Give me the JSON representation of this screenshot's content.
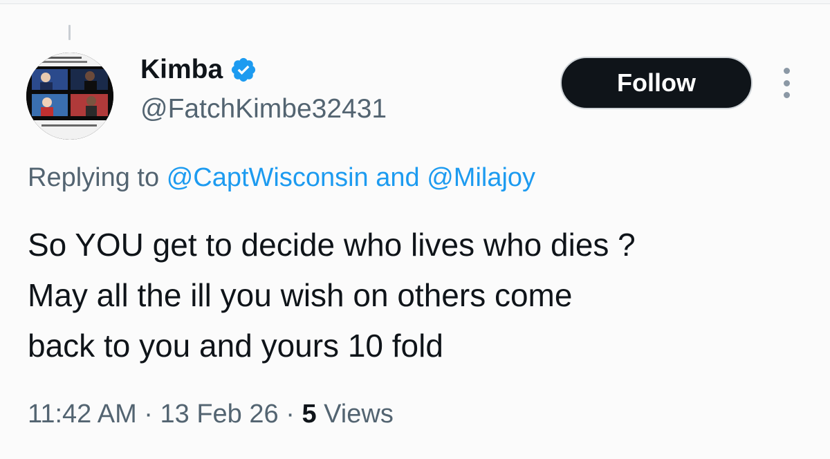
{
  "author": {
    "display_name": "Kimba",
    "handle": "@FatchKimbe32431",
    "verified": true
  },
  "follow_button": {
    "label": "Follow"
  },
  "more_menu": {
    "icon": "more-vertical-icon"
  },
  "reply_context": {
    "prefix": "Replying to",
    "mentions": [
      "@CaptWisconsin",
      "@Milajoy"
    ],
    "joiner": "and"
  },
  "tweet": {
    "lines": [
      "So YOU get to decide who lives who dies ?",
      "May all the ill you wish on others come",
      "back to you and yours 10 fold"
    ]
  },
  "meta": {
    "time": "11:42 AM",
    "date": "13 Feb 26",
    "separator": "·",
    "views_count": "5",
    "views_label": "Views"
  },
  "colors": {
    "link": "#1d9bf0",
    "secondary_text": "#536471",
    "primary_text": "#0f1419",
    "follow_bg": "#0f1419",
    "verified": "#1d9bf0"
  }
}
